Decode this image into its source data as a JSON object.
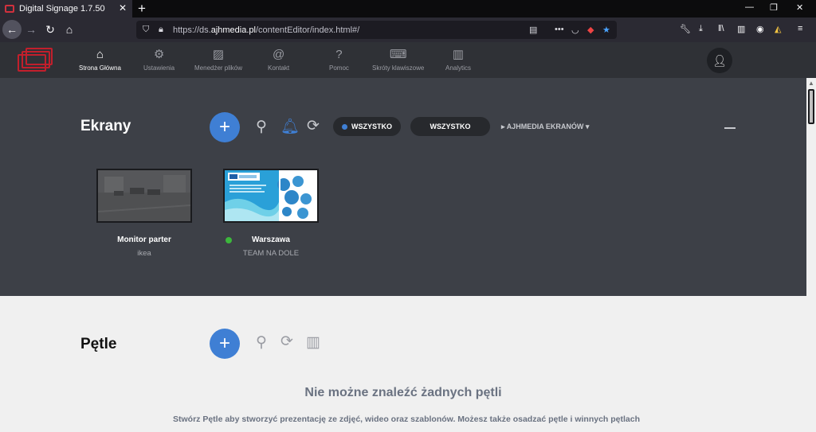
{
  "browser": {
    "tab_title": "Digital Signage 1.7.50",
    "url_prefix": "https://ds.",
    "url_domain": "ajhmedia.pl",
    "url_suffix": "/contentEditor/index.html#/"
  },
  "app": {
    "nav": [
      {
        "label": "Strona Główna",
        "icon": "home-icon"
      },
      {
        "label": "Ustawienia",
        "icon": "gear-icon"
      },
      {
        "label": "Menedżer plików",
        "icon": "images-icon"
      },
      {
        "label": "Kontakt",
        "icon": "at-icon"
      },
      {
        "label": "Pomoc",
        "icon": "question-icon"
      },
      {
        "label": "Skróty klawiszowe",
        "icon": "keyboard-icon"
      },
      {
        "label": "Analytics",
        "icon": "analytics-icon"
      }
    ]
  },
  "ekrany": {
    "title": "Ekrany",
    "filter_status": "WSZYSTKO",
    "filter_group": "WSZYSTKO",
    "dropdown": "AJHMEDIA EKRANÓW",
    "screens": [
      {
        "name": "Monitor parter",
        "sub": "ikea",
        "online": false
      },
      {
        "name": "Warszawa",
        "sub": "TEAM NA DOLE",
        "online": true
      }
    ]
  },
  "petle": {
    "title": "Pętle",
    "empty_title": "Nie możne znaleźć żadnych pętli",
    "empty_desc": "Stwórz Pętle aby stworzyć prezentację ze zdjęć, wideo oraz szablonów. Możesz także osadzać pętle i winnych pętlach"
  },
  "colors": {
    "accent": "#3f7fd4",
    "online": "#3cb73c",
    "brand": "#c21f2c"
  }
}
